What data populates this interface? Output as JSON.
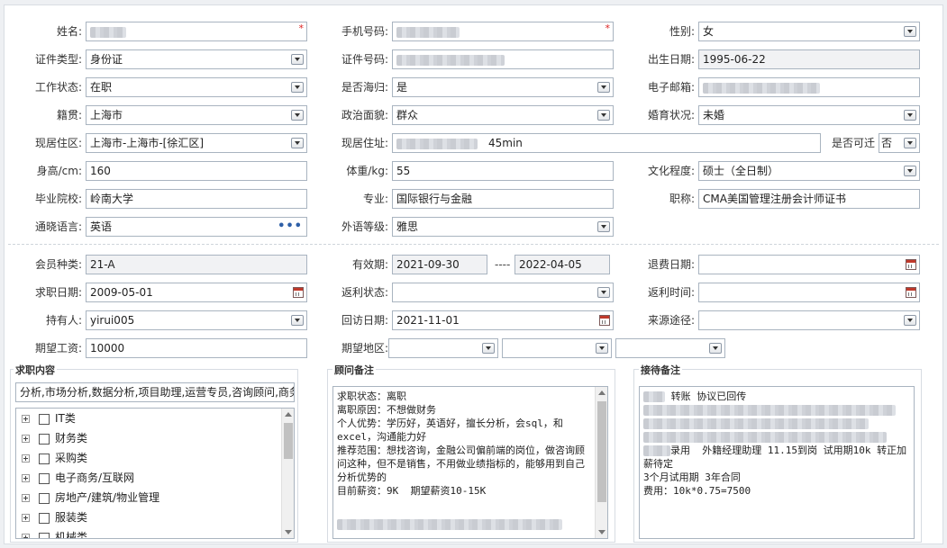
{
  "personal": {
    "name_label": "姓名:",
    "phone_label": "手机号码:",
    "gender_label": "性别:",
    "gender_value": "女",
    "id_type_label": "证件类型:",
    "id_type_value": "身份证",
    "id_no_label": "证件号码:",
    "birth_label": "出生日期:",
    "birth_value": "1995-06-22",
    "work_status_label": "工作状态:",
    "work_status_value": "在职",
    "overseas_label": "是否海归:",
    "overseas_value": "是",
    "email_label": "电子邮箱:",
    "native_label": "籍贯:",
    "native_value": "上海市",
    "political_label": "政治面貌:",
    "political_value": "群众",
    "marital_label": "婚育状况:",
    "marital_value": "未婚",
    "residence_label": "现居住区:",
    "residence_value": "上海市-上海市-[徐汇区]",
    "address_label": "现居住址:",
    "address_suffix": "45min",
    "relocate_label": "是否可迁",
    "relocate_value": "否",
    "height_label": "身高/cm:",
    "height_value": "160",
    "weight_label": "体重/kg:",
    "weight_value": "55",
    "education_label": "文化程度:",
    "education_value": "硕士（全日制）",
    "school_label": "毕业院校:",
    "school_value": "岭南大学",
    "major_label": "专业:",
    "major_value": "国际银行与金融",
    "title_label": "职称:",
    "title_value": "CMA美国管理注册会计师证书",
    "language_label": "通晓语言:",
    "language_value": "英语",
    "lang_level_label": "外语等级:",
    "lang_level_value": "雅思"
  },
  "member": {
    "type_label": "会员种类:",
    "type_value": "21-A",
    "validity_label": "有效期:",
    "validity_start": "2021-09-30",
    "validity_sep": "----",
    "validity_end": "2022-04-05",
    "refund_date_label": "退费日期:",
    "job_date_label": "求职日期:",
    "job_date_value": "2009-05-01",
    "rebate_status_label": "返利状态:",
    "rebate_time_label": "返利时间:",
    "holder_label": "持有人:",
    "holder_value": "yirui005",
    "visit_date_label": "回访日期:",
    "visit_date_value": "2021-11-01",
    "source_label": "来源途径:",
    "salary_label": "期望工资:",
    "salary_value": "10000",
    "region_label": "期望地区:"
  },
  "job_content": {
    "title": "求职内容",
    "summary": "分析,市场分析,数据分析,项目助理,运营专员,咨询顾问,商务",
    "categories": [
      "IT类",
      "财务类",
      "采购类",
      "电子商务/互联网",
      "房地产/建筑/物业管理",
      "服装类",
      "机械类"
    ]
  },
  "consultant_notes": {
    "title": "顾问备注",
    "text": "求职状态：离职\n离职原因：不想做财务\n个人优势：学历好，英语好，擅长分析，会sql，和excel，沟通能力好\n推荐范围：想找咨询，金融公司偏前端的岗位，做咨询顾问这种，但不是销售，不用做业绩指标的，能够用到自己分析优势的\n目前薪资：9K  期望薪资10-15K"
  },
  "reception_notes": {
    "title": "接待备注",
    "line1_suffix": " 转账 协议已回传",
    "line_offer": "录用  外籍经理助理 11.15到岗 试用期10k 转正加薪待定",
    "line_contract": "3个月试用期 3年合同",
    "line_fee": "费用：10k*0.75=7500"
  }
}
